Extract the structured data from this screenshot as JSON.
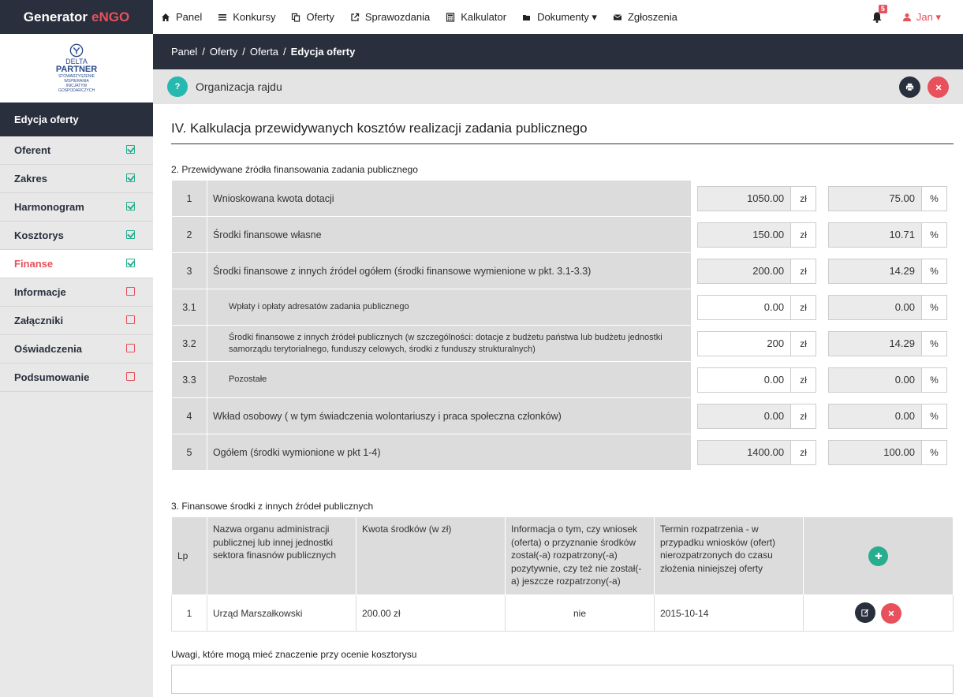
{
  "brand": {
    "part1": "Generator",
    "part2": "eNGO"
  },
  "nav": [
    {
      "label": "Panel",
      "icon": "home-icon"
    },
    {
      "label": "Konkursy",
      "icon": "list-icon"
    },
    {
      "label": "Oferty",
      "icon": "copy-icon"
    },
    {
      "label": "Sprawozdania",
      "icon": "external-link-icon"
    },
    {
      "label": "Kalkulator",
      "icon": "calculator-icon"
    },
    {
      "label": "Dokumenty ▾",
      "icon": "folder-icon"
    },
    {
      "label": "Zgłoszenia",
      "icon": "envelope-icon"
    }
  ],
  "notifications": {
    "count": "5"
  },
  "user": {
    "name": "Jan ▾"
  },
  "logo": {
    "line1": "DELTA",
    "line2": "PARTNER",
    "line3": "STOWARZYSZENIE",
    "line4": "WSPIERANIA",
    "line5": "INICJATYW",
    "line6": "GOSPODARCZYCH"
  },
  "sidebar": {
    "heading": "Edycja oferty",
    "items": [
      {
        "label": "Oferent",
        "done": true
      },
      {
        "label": "Zakres",
        "done": true
      },
      {
        "label": "Harmonogram",
        "done": true
      },
      {
        "label": "Kosztorys",
        "done": true
      },
      {
        "label": "Finanse",
        "done": true,
        "active": true
      },
      {
        "label": "Informacje",
        "done": false
      },
      {
        "label": "Załączniki",
        "done": false
      },
      {
        "label": "Oświadczenia",
        "done": false
      },
      {
        "label": "Podsumowanie",
        "done": false
      }
    ]
  },
  "breadcrumb": {
    "b1": "Panel",
    "b2": "Oferty",
    "b3": "Oferta",
    "b4": "Edycja oferty",
    "sep": "/"
  },
  "titlebar": {
    "title": "Organizacja rajdu",
    "help": "?"
  },
  "section": {
    "title": "IV. Kalkulacja przewidywanych kosztów realizacji zadania publicznego"
  },
  "funding": {
    "title": "2. Przewidywane źródła finansowania zadania publicznego",
    "currency": "zł",
    "percent": "%",
    "rows": [
      {
        "lp": "1",
        "label": "Wnioskowana kwota dotacji",
        "amount": "1050.00",
        "pct": "75.00",
        "indent": false,
        "editable": false
      },
      {
        "lp": "2",
        "label": "Środki finansowe własne",
        "amount": "150.00",
        "pct": "10.71",
        "indent": false,
        "editable": false
      },
      {
        "lp": "3",
        "label": "Środki finansowe z innych źródeł ogółem (środki finansowe wymienione w pkt. 3.1-3.3)",
        "amount": "200.00",
        "pct": "14.29",
        "indent": false,
        "editable": false
      },
      {
        "lp": "3.1",
        "label": "Wpłaty i opłaty adresatów zadania publicznego",
        "amount": "0.00",
        "pct": "0.00",
        "indent": true,
        "editable": true
      },
      {
        "lp": "3.2",
        "label": "Środki finansowe z innych źródeł publicznych (w szczególności: dotacje z budżetu państwa lub budżetu jednostki samorządu terytorialnego, funduszy celowych, środki z funduszy strukturalnych)",
        "amount": "200",
        "pct": "14.29",
        "indent": true,
        "editable": true
      },
      {
        "lp": "3.3",
        "label": "Pozostałe",
        "amount": "0.00",
        "pct": "0.00",
        "indent": true,
        "editable": true
      },
      {
        "lp": "4",
        "label": "Wkład osobowy ( w tym świadczenia wolontariuszy i praca społeczna członków)",
        "amount": "0.00",
        "pct": "0.00",
        "indent": false,
        "editable": false
      },
      {
        "lp": "5",
        "label": "Ogółem (środki wymionione w pkt 1-4)",
        "amount": "1400.00",
        "pct": "100.00",
        "indent": false,
        "editable": false
      }
    ]
  },
  "sources": {
    "title": "3. Finansowe środki z innych źródeł publicznych",
    "headers": {
      "lp": "Lp",
      "name": "Nazwa organu administracji publicznej lub innej jednostki sektora finasnów publicznych",
      "amount": "Kwota środków (w zł)",
      "info": "Informacja o tym, czy wniosek (oferta) o przyznanie środków został(-a) rozpatrzony(-a) pozytywnie, czy też nie został(-a) jeszcze rozpatrzony(-a)",
      "term": "Termin rozpatrzenia - w przypadku wniosków (ofert) nierozpatrzonych do czasu złożenia niniejszej oferty"
    },
    "rows": [
      {
        "lp": "1",
        "name": "Urząd Marszałkowski",
        "amount": "200.00 zł",
        "info": "nie",
        "term": "2015-10-14"
      }
    ]
  },
  "notes": {
    "label": "Uwagi, które mogą mieć znaczenie przy ocenie kosztorysu",
    "value": ""
  },
  "colors": {
    "dark": "#2a2f3d",
    "accent": "#e8505b",
    "teal": "#27b9b0",
    "green": "#27ae8f"
  }
}
